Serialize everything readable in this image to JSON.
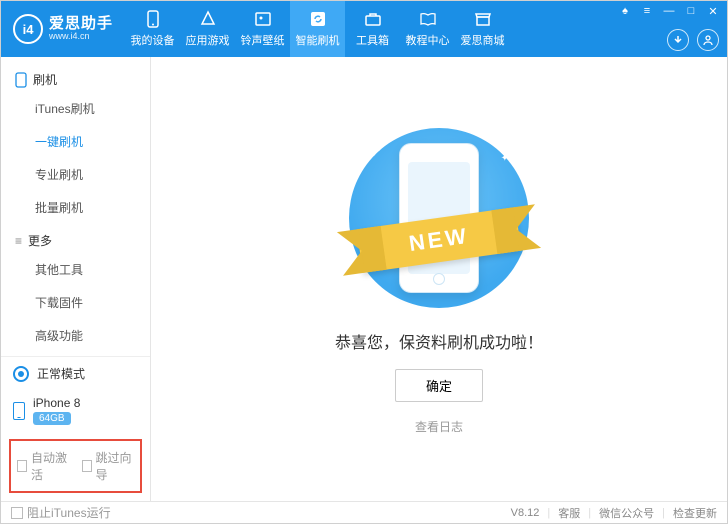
{
  "brand": {
    "name": "爱思助手",
    "url": "www.i4.cn",
    "logo_text": "i4"
  },
  "nav": [
    {
      "label": "我的设备"
    },
    {
      "label": "应用游戏"
    },
    {
      "label": "铃声壁纸"
    },
    {
      "label": "智能刷机"
    },
    {
      "label": "工具箱"
    },
    {
      "label": "教程中心"
    },
    {
      "label": "爱思商城"
    }
  ],
  "nav_active_index": 3,
  "sidebar": {
    "section1": {
      "title": "刷机",
      "items": [
        "iTunes刷机",
        "一键刷机",
        "专业刷机",
        "批量刷机"
      ],
      "active_index": 1
    },
    "section2": {
      "title": "更多",
      "items": [
        "其他工具",
        "下载固件",
        "高级功能"
      ]
    },
    "mode": "正常模式",
    "device": {
      "name": "iPhone 8",
      "storage": "64GB"
    },
    "options": {
      "auto_activate": "自动激活",
      "skip_guide": "跳过向导"
    }
  },
  "content": {
    "ribbon": "NEW",
    "message": "恭喜您，保资料刷机成功啦！",
    "ok": "确定",
    "view_log": "查看日志"
  },
  "statusbar": {
    "block_itunes": "阻止iTunes运行",
    "version": "V8.12",
    "support": "客服",
    "wechat": "微信公众号",
    "check_update": "检查更新"
  }
}
